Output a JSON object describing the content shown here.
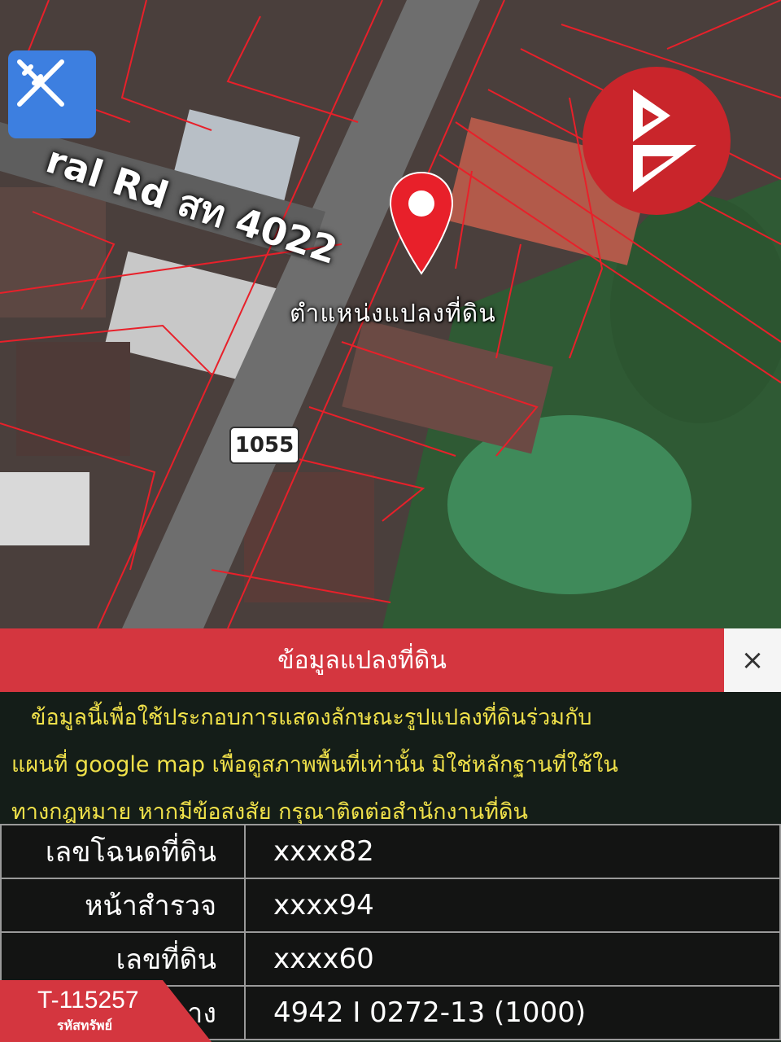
{
  "map": {
    "road_label": "ral Rd สท 4022",
    "route_number": "1055",
    "marker_label": "ตำแหน่งแปลงที่ดิน",
    "tool_icon": "ruler-pencil-icon",
    "logo_icon": "brand-logo-icon",
    "pin_icon": "map-pin-icon",
    "boundary_color": "#e8202a",
    "pin_color": "#e8202a"
  },
  "panel": {
    "title": "ข้อมูลแปลงที่ดิน",
    "close_label": "×",
    "notice_lines": [
      "ข้อมูลนี้เพื่อใช้ประกอบการแสดงลักษณะรูปแปลงที่ดินร่วมกับ",
      "แผนที่ google map เพื่อดูสภาพพื้นที่เท่านั้น มิใช่หลักฐานที่ใช้ใน",
      "ทางกฎหมาย หากมีข้อสงสัย กรุณาติดต่อสำนักงานที่ดิน"
    ],
    "rows": [
      {
        "label": "เลขโฉนดที่ดิน",
        "value": "xxxx82"
      },
      {
        "label": "หน้าสำรวจ",
        "value": "xxxx94"
      },
      {
        "label": "เลขที่ดิน",
        "value": "xxxx60"
      },
      {
        "label": "ระวาง",
        "value": "4942 I 0272-13 (1000)"
      }
    ]
  },
  "asset": {
    "code": "T-115257",
    "caption": "รหัสทรัพย์"
  }
}
